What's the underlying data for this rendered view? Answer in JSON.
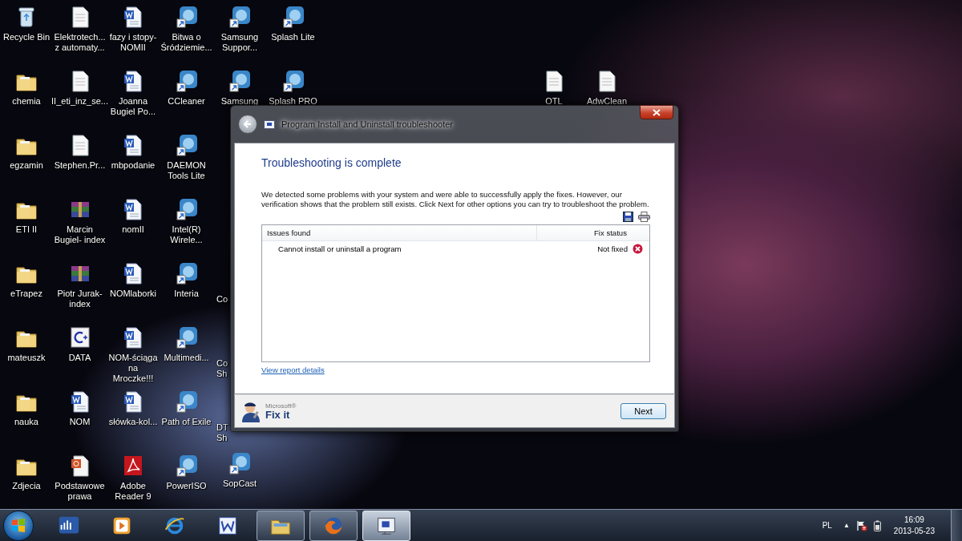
{
  "desktop": {
    "columns": [
      {
        "icons": [
          {
            "label": "Recycle Bin",
            "kind": "bin"
          },
          {
            "label": "chemia",
            "kind": "folder"
          },
          {
            "label": "egzamin",
            "kind": "folder"
          },
          {
            "label": "ETI II",
            "kind": "folder"
          },
          {
            "label": "eTrapez",
            "kind": "folder"
          },
          {
            "label": "mateuszk",
            "kind": "folder"
          },
          {
            "label": "nauka",
            "kind": "folder"
          },
          {
            "label": "Zdjecia",
            "kind": "folder"
          }
        ]
      },
      {
        "icons": [
          {
            "label": "Elektrotech...\nz automaty...",
            "kind": "file"
          },
          {
            "label": "II_eti_inz_se...",
            "kind": "file"
          },
          {
            "label": "Stephen.Pr...",
            "kind": "file"
          },
          {
            "label": "Marcin\nBugiel- index",
            "kind": "archive"
          },
          {
            "label": "Piotr Jurak-\nindex",
            "kind": "archive"
          },
          {
            "label": "DATA",
            "kind": "code"
          },
          {
            "label": "NOM",
            "kind": "document"
          },
          {
            "label": "Podstawowe\nprawa",
            "kind": "slides"
          }
        ]
      },
      {
        "icons": [
          {
            "label": "fazy i stopy-\nNOMII",
            "kind": "document"
          },
          {
            "label": "Joanna\nBugiel Po...",
            "kind": "document"
          },
          {
            "label": "mbpodanie",
            "kind": "document"
          },
          {
            "label": "nomII",
            "kind": "document"
          },
          {
            "label": "NOMlaborki",
            "kind": "document"
          },
          {
            "label": "NOM-ściąga\nna Mroczke!!!",
            "kind": "document"
          },
          {
            "label": "słówka-kol...",
            "kind": "document"
          },
          {
            "label": "Adobe\nReader 9",
            "kind": "pdf"
          }
        ]
      },
      {
        "icons": [
          {
            "label": "Bitwa o\nŚródziemie...",
            "kind": "app"
          },
          {
            "label": "CCleaner",
            "kind": "app"
          },
          {
            "label": "DAEMON\nTools Lite",
            "kind": "app"
          },
          {
            "label": "Intel(R)\nWirele...",
            "kind": "app"
          },
          {
            "label": "Interia",
            "kind": "app"
          },
          {
            "label": "Multimedi...",
            "kind": "app"
          },
          {
            "label": "Path of Exile",
            "kind": "app"
          },
          {
            "label": "PowerISO",
            "kind": "app"
          }
        ]
      },
      {
        "icons": [
          {
            "label": "Samsung\nSuppor...",
            "kind": "app"
          },
          {
            "label": "Samsung",
            "kind": "app"
          }
        ],
        "lower_icons": [
          {
            "label": "Co",
            "kind": "clipped"
          },
          {
            "label": "Co\nSh",
            "kind": "clipped"
          },
          {
            "label": "DT\nSh",
            "kind": "clipped"
          },
          {
            "label": "SopCast",
            "kind": "app"
          }
        ]
      },
      {
        "icons": [
          {
            "label": "Splash Lite",
            "kind": "app"
          },
          {
            "label": "Splash PRO",
            "kind": "app"
          }
        ]
      }
    ],
    "right_icons": [
      {
        "label": "OTL",
        "kind": "file"
      },
      {
        "label": "AdwClean",
        "kind": "file"
      }
    ]
  },
  "dialog": {
    "title": "Program Install and Uninstall troubleshooter",
    "heading": "Troubleshooting is complete",
    "message": "We detected some problems with your system and were able to successfully apply the fixes. However, our verification shows that the problem still exists. Click Next for other options you can try to troubleshoot the problem.",
    "table": {
      "columns": [
        "Issues found",
        "Fix status"
      ],
      "rows": [
        {
          "issue": "Cannot install or uninstall a program",
          "status": "Not fixed",
          "fixed": false
        }
      ]
    },
    "link": "View report details",
    "brand": {
      "maker": "Microsoft®",
      "name": "Fix it"
    },
    "buttons": [
      "Next"
    ]
  },
  "taskbar": {
    "items": [
      {
        "kind": "wimax",
        "running": false,
        "selected": false
      },
      {
        "kind": "media",
        "running": false,
        "selected": false
      },
      {
        "kind": "browser",
        "running": false,
        "selected": false
      },
      {
        "kind": "word",
        "running": false,
        "selected": false
      },
      {
        "kind": "explorer",
        "running": true,
        "selected": false
      },
      {
        "kind": "firefox",
        "running": true,
        "selected": false
      },
      {
        "kind": "troubleshooter",
        "running": true,
        "selected": true
      }
    ],
    "language": "PL",
    "tray_toggle": "▲",
    "time": "16:09",
    "date": "2013-05-23"
  }
}
